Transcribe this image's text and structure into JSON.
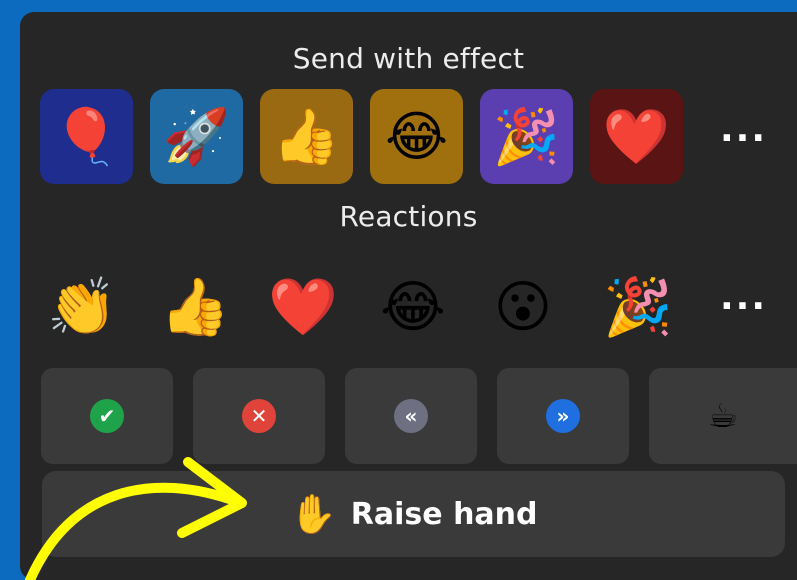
{
  "send_with_effect": {
    "title": "Send with effect",
    "effects": [
      {
        "name": "balloon",
        "glyph": "🎈",
        "bg": "#1f2d8f"
      },
      {
        "name": "rocket",
        "glyph": "🚀",
        "bg": "#1f6aa3"
      },
      {
        "name": "thumbs-up",
        "glyph": "👍",
        "bg": "#9a6a12"
      },
      {
        "name": "laughing",
        "glyph": "😂",
        "bg": "#a0700f"
      },
      {
        "name": "party",
        "glyph": "🎉",
        "bg": "#5b3fb0"
      },
      {
        "name": "heart",
        "glyph": "❤️",
        "bg": "#5a1414"
      }
    ],
    "more": "..."
  },
  "reactions": {
    "title": "Reactions",
    "items": [
      {
        "name": "clap",
        "glyph": "👏"
      },
      {
        "name": "thumbs-up",
        "glyph": "👍"
      },
      {
        "name": "heart",
        "glyph": "❤️"
      },
      {
        "name": "laughing",
        "glyph": "😂"
      },
      {
        "name": "surprised",
        "glyph": "😮"
      },
      {
        "name": "party",
        "glyph": "🎉"
      }
    ],
    "more": "..."
  },
  "status_buttons": [
    {
      "name": "yes",
      "glyph": "✔",
      "color": "#1fa34a"
    },
    {
      "name": "no",
      "glyph": "✕",
      "color": "#e0433a"
    },
    {
      "name": "slower",
      "glyph": "«",
      "color": "#6e6f80"
    },
    {
      "name": "faster",
      "glyph": "»",
      "color": "#1f6fe0"
    },
    {
      "name": "coffee-break",
      "glyph": "☕",
      "color": "transparent"
    }
  ],
  "raise_hand": {
    "glyph": "✋",
    "label": "Raise hand"
  },
  "colors": {
    "page_bg": "#0c6bbf",
    "panel_bg": "#262626",
    "button_bg": "#3a3a3a",
    "arrow": "#ffff00"
  }
}
